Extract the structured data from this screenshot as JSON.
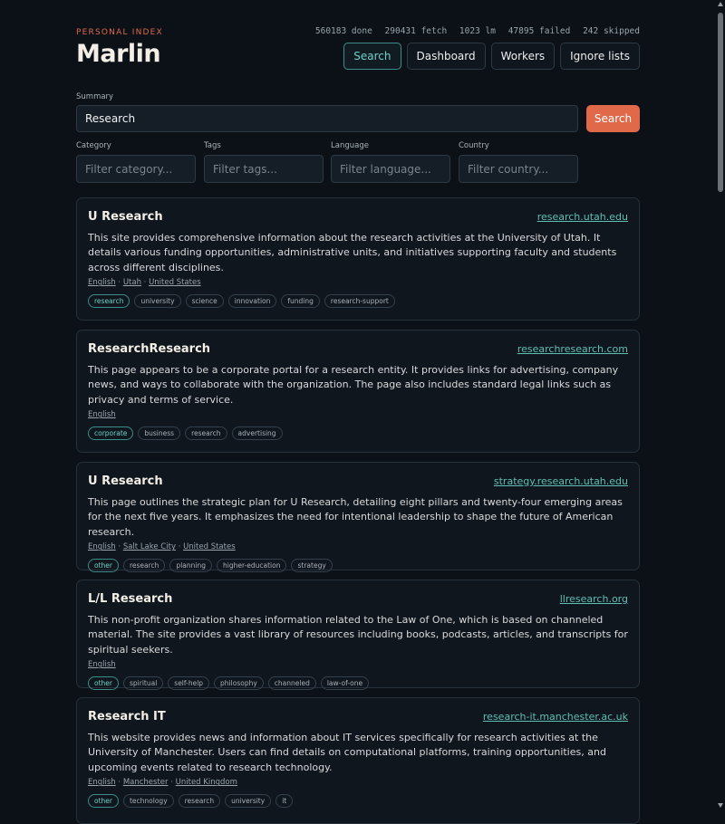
{
  "header": {
    "eyebrow": "PERSONAL INDEX",
    "title": "Marlin",
    "stats": [
      "560183 done",
      "290431 fetch",
      "1023 lm",
      "47895 failed",
      "242 skipped"
    ]
  },
  "nav": [
    {
      "label": "Search",
      "active": true
    },
    {
      "label": "Dashboard",
      "active": false
    },
    {
      "label": "Workers",
      "active": false
    },
    {
      "label": "Ignore lists",
      "active": false
    }
  ],
  "search": {
    "summary_label": "Summary",
    "summary_value": "Research",
    "button_label": "Search",
    "filters": [
      {
        "label": "Category",
        "placeholder": "Filter category..."
      },
      {
        "label": "Tags",
        "placeholder": "Filter tags..."
      },
      {
        "label": "Language",
        "placeholder": "Filter language..."
      },
      {
        "label": "Country",
        "placeholder": "Filter country..."
      }
    ]
  },
  "results": [
    {
      "title": "U Research",
      "domain": "research.utah.edu",
      "description": "This site provides comprehensive information about the research activities at the University of Utah. It details various funding opportunities, administrative units, and initiatives supporting faculty and students across different disciplines.",
      "meta": [
        "English",
        "Utah",
        "United States"
      ],
      "tags": [
        "research",
        "university",
        "science",
        "innovation",
        "funding",
        "research-support"
      ]
    },
    {
      "title": "ResearchResearch",
      "domain": "researchresearch.com",
      "description": "This page appears to be a corporate portal for a research entity. It provides links for advertising, company news, and ways to collaborate with the organization. The page also includes standard legal links such as privacy and terms of service.",
      "meta": [
        "English"
      ],
      "tags": [
        "corporate",
        "business",
        "research",
        "advertising"
      ]
    },
    {
      "title": "U Research",
      "domain": "strategy.research.utah.edu",
      "description": "This page outlines the strategic plan for U Research, detailing eight pillars and twenty-four emerging areas for the next five years. It emphasizes the need for intentional leadership to shape the future of American research.",
      "meta": [
        "English",
        "Salt Lake City",
        "United States"
      ],
      "tags": [
        "other",
        "research",
        "planning",
        "higher-education",
        "strategy"
      ]
    },
    {
      "title": "L/L Research",
      "domain": "llresearch.org",
      "description": "This non-profit organization shares information related to the Law of One, which is based on channeled material. The site provides a vast library of resources including books, podcasts, articles, and transcripts for spiritual seekers.",
      "meta": [
        "English"
      ],
      "tags": [
        "other",
        "spiritual",
        "self-help",
        "philosophy",
        "channeled",
        "law-of-one"
      ]
    },
    {
      "title": "Research IT",
      "domain": "research-it.manchester.ac.uk",
      "description": "This website provides news and information about IT services specifically for research activities at the University of Manchester. Users can find details on computational platforms, training opportunities, and upcoming events related to research technology.",
      "meta": [
        "English",
        "Manchester",
        "United Kingdom"
      ],
      "tags": [
        "other",
        "technology",
        "research",
        "university",
        "it"
      ]
    }
  ]
}
